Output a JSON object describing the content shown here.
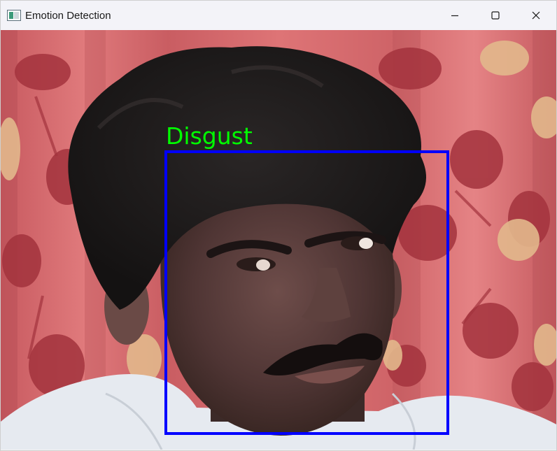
{
  "window": {
    "title": "Emotion Detection",
    "controls": {
      "minimize_icon": "minimize-icon",
      "maximize_icon": "maximize-icon",
      "close_icon": "close-icon"
    }
  },
  "detection": {
    "emotion_label": "Disgust",
    "label_color": "#00ff00",
    "box_color": "#0000ff"
  },
  "colors": {
    "titlebar_bg": "#f3f3f8",
    "curtain_base": "#d8686c",
    "flower_dark": "#a8343c",
    "flower_light": "#e3b98a"
  }
}
